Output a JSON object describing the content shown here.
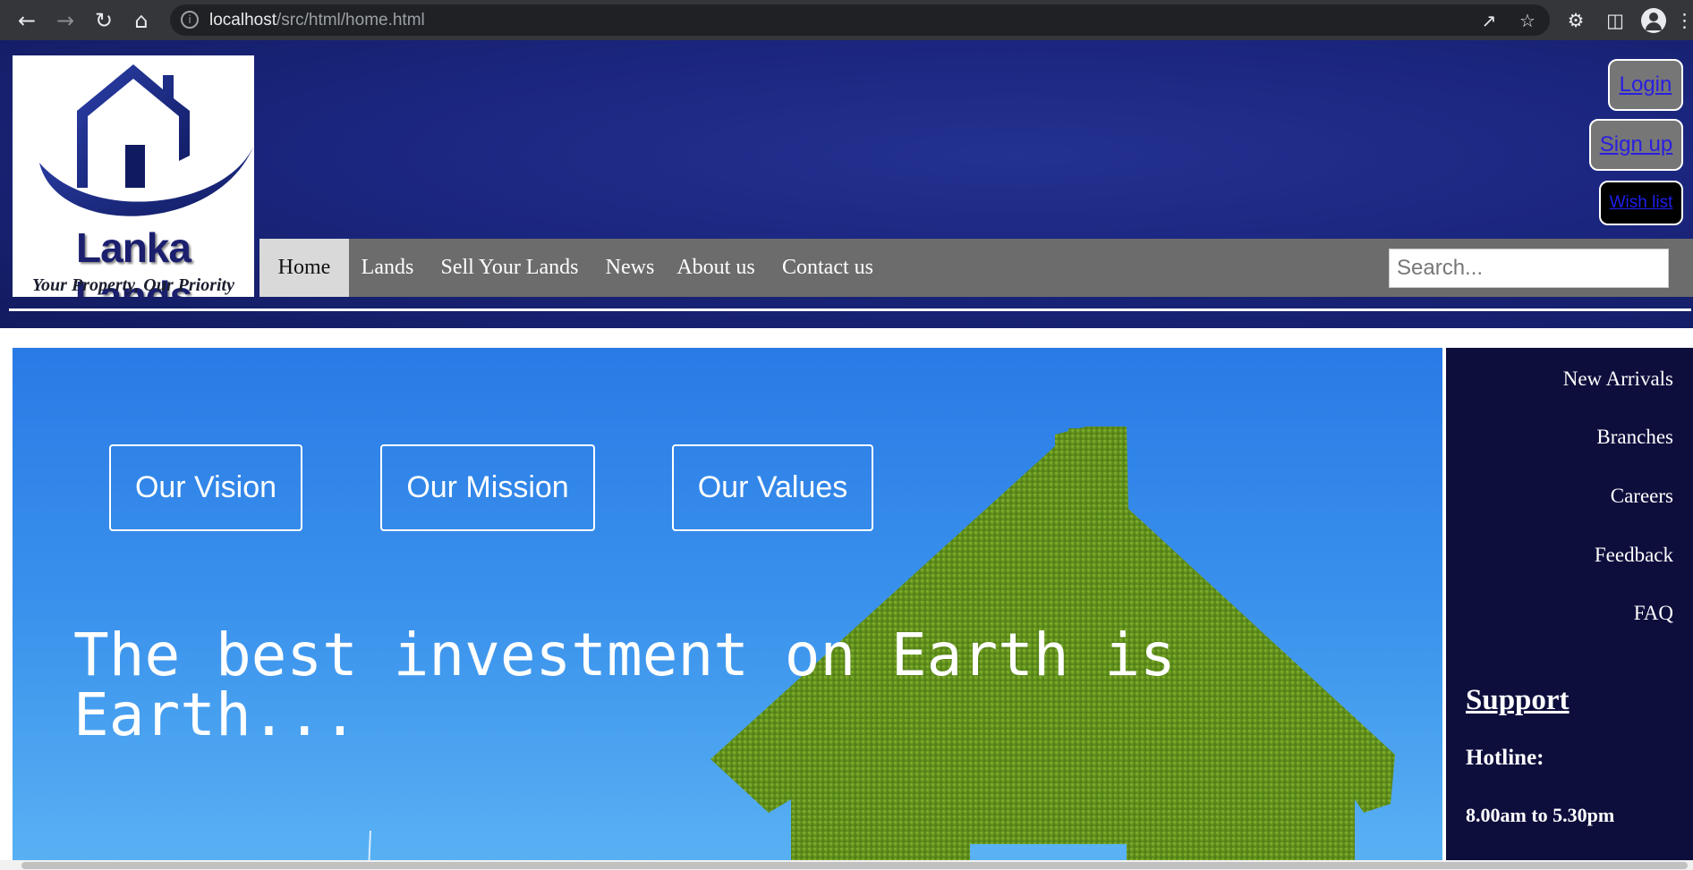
{
  "browser": {
    "url_host": "localhost",
    "url_path": "/src/html/home.html",
    "icons": {
      "back": "back-arrow-icon",
      "forward": "forward-arrow-icon",
      "reload": "reload-icon",
      "home": "home-icon",
      "info": "info-icon",
      "share": "share-icon",
      "bookmark": "star-icon",
      "extensions": "puzzle-icon",
      "sidepanel": "side-panel-icon",
      "profile": "profile-icon",
      "menu": "kebab-menu-icon"
    }
  },
  "header": {
    "logo": {
      "brand": "Lanka Lands",
      "tagline": "Your Property, Our Priority"
    },
    "login_label": "Login",
    "signup_label": "Sign up",
    "wishlist_label": "Wish list"
  },
  "nav": {
    "items": [
      "Home",
      "Lands",
      "Sell Your Lands",
      "News",
      "About us",
      "Contact us"
    ],
    "active": "Home",
    "search_placeholder": "Search..."
  },
  "hero": {
    "boxes": [
      "Our Vision",
      "Our Mission",
      "Our Values"
    ],
    "quote": "The best investment on Earth is Earth..."
  },
  "sidebar": {
    "links": [
      "New Arrivals",
      "Branches",
      "Careers",
      "Feedback",
      "FAQ"
    ],
    "support_title": "Support",
    "hotline_label": "Hotline:",
    "hours": "8.00am to 5.30pm"
  },
  "colors": {
    "header_bg": "#1b2680",
    "nav_bg": "#6c6c6c",
    "sidebar_bg": "#0e0e3d",
    "hero_sky": "#3a92ec",
    "grass": "#6a9a22"
  }
}
